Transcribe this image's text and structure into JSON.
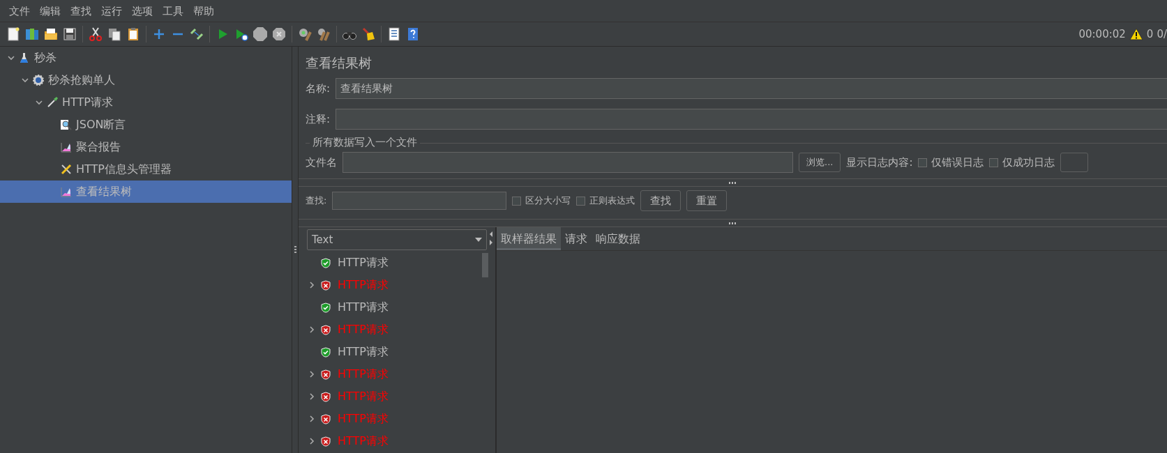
{
  "menu": [
    "文件",
    "编辑",
    "查找",
    "运行",
    "选项",
    "工具",
    "帮助"
  ],
  "status": {
    "timer": "00:00:02",
    "warnings": "0",
    "threads": "0/"
  },
  "tree": [
    {
      "label": "秒杀",
      "kind": "plan",
      "expanded": true,
      "selected": false,
      "children": [
        {
          "label": "秒杀抢购单人",
          "kind": "group",
          "expanded": true,
          "selected": false,
          "children": [
            {
              "label": "HTTP请求",
              "kind": "sampler",
              "expanded": true,
              "selected": false,
              "children": [
                {
                  "label": "JSON断言",
                  "kind": "assertion",
                  "selected": false
                },
                {
                  "label": "聚合报告",
                  "kind": "listener",
                  "selected": false
                },
                {
                  "label": "HTTP信息头管理器",
                  "kind": "config",
                  "selected": false
                },
                {
                  "label": "查看结果树",
                  "kind": "listener",
                  "selected": true
                }
              ]
            }
          ]
        }
      ]
    }
  ],
  "panel": {
    "title": "查看结果树",
    "name_label": "名称:",
    "name_value": "查看结果树",
    "comment_label": "注释:",
    "file_group": "所有数据写入一个文件",
    "file_label": "文件名",
    "browse": "浏览...",
    "log_label": "显示日志内容:",
    "log_options": [
      {
        "label": "仅错误日志",
        "checked": false
      },
      {
        "label": "仅成功日志",
        "checked": false
      }
    ],
    "search_label": "查找:",
    "search_options": [
      {
        "label": "区分大小写",
        "checked": false
      },
      {
        "label": "正则表达式",
        "checked": false
      }
    ],
    "find": "查找",
    "reset": "重置",
    "renderer": "Text",
    "results": [
      {
        "label": "HTTP请求",
        "kind": "success"
      },
      {
        "label": "HTTP请求",
        "kind": "error"
      },
      {
        "label": "HTTP请求",
        "kind": "success"
      },
      {
        "label": "HTTP请求",
        "kind": "error"
      },
      {
        "label": "HTTP请求",
        "kind": "success"
      },
      {
        "label": "HTTP请求",
        "kind": "error"
      },
      {
        "label": "HTTP请求",
        "kind": "error"
      },
      {
        "label": "HTTP请求",
        "kind": "error"
      },
      {
        "label": "HTTP请求",
        "kind": "error"
      }
    ],
    "tabs": [
      {
        "label": "取样器结果",
        "selected": true
      },
      {
        "label": "请求",
        "selected": false
      },
      {
        "label": "响应数据",
        "selected": false
      }
    ]
  }
}
